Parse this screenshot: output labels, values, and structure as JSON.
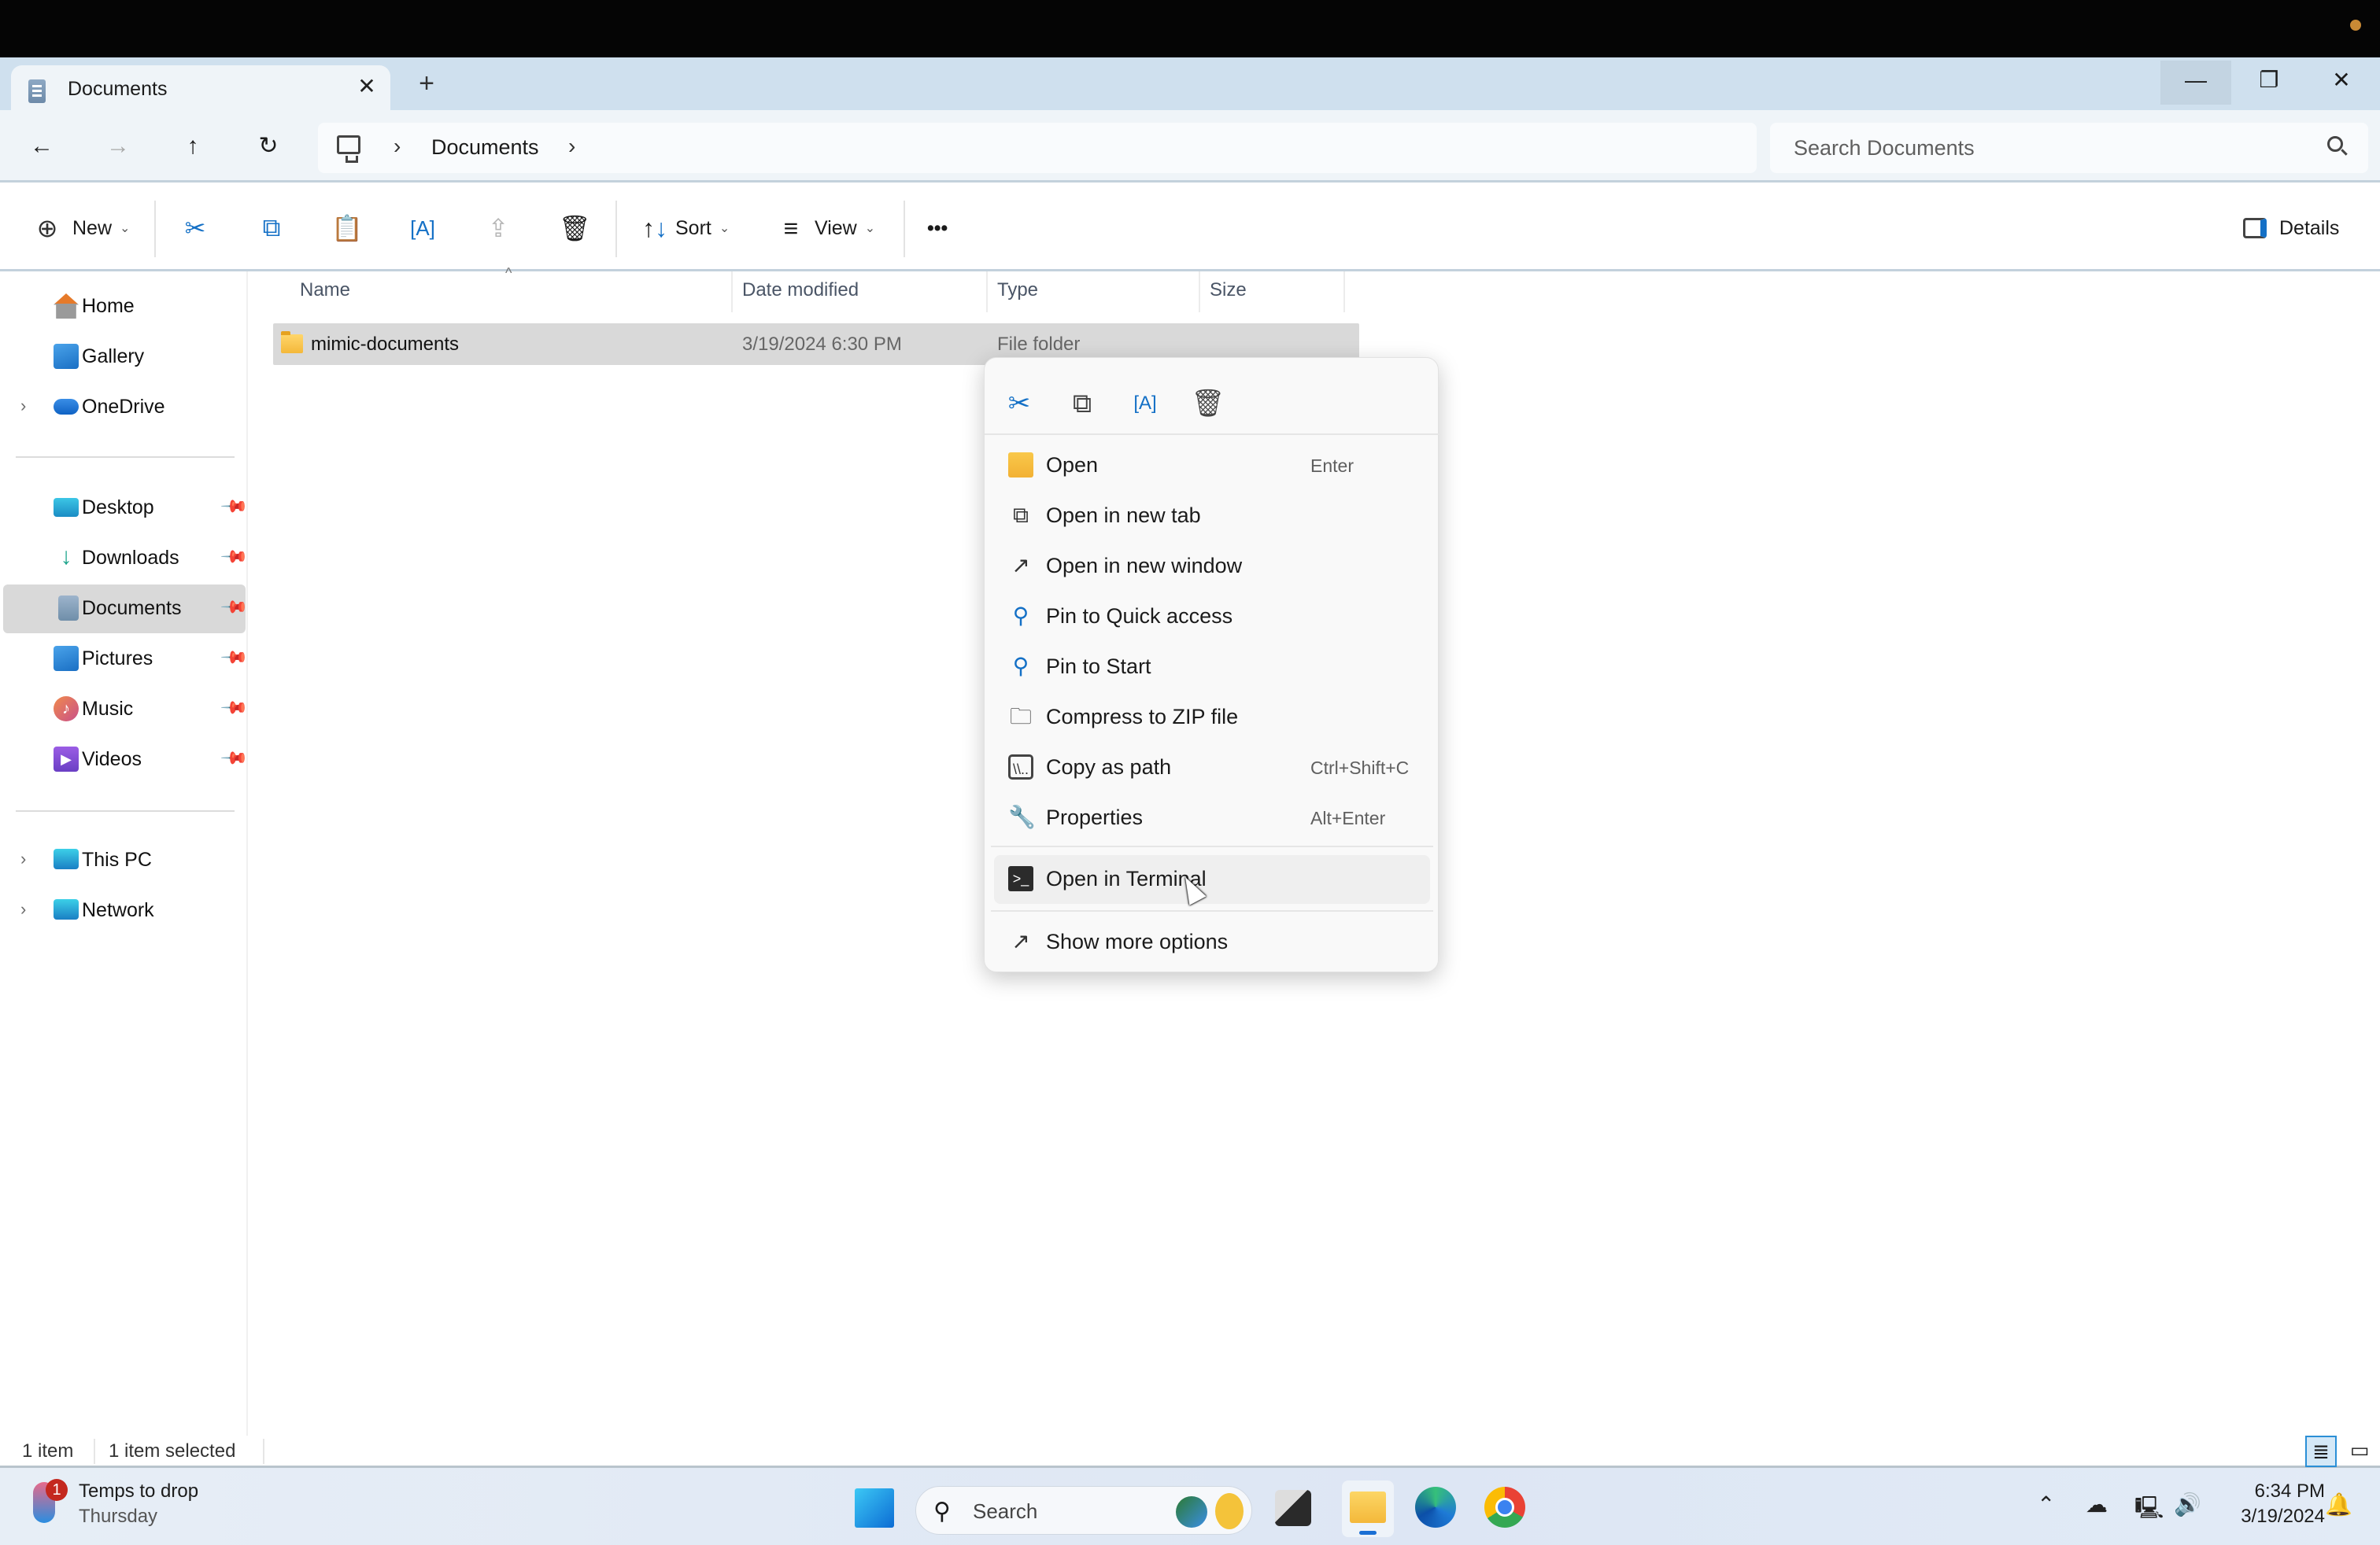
{
  "window": {
    "tab_title": "Documents",
    "tab_icon": "documents-icon",
    "new_tab_label": "+",
    "controls": {
      "minimize": "minimize-icon",
      "restore": "restore-icon",
      "close": "close-icon"
    }
  },
  "address_bar": {
    "root_icon": "this-pc-icon",
    "breadcrumbs": [
      "Documents"
    ],
    "search_placeholder": "Search Documents"
  },
  "nav_buttons": [
    "back",
    "forward",
    "up",
    "refresh"
  ],
  "toolbar": {
    "new_label": "New",
    "sort_label": "Sort",
    "view_label": "View",
    "more_label": "•••",
    "details_label": "Details",
    "icons": [
      "cut-icon",
      "copy-icon",
      "paste-icon",
      "rename-icon",
      "share-icon",
      "delete-icon"
    ]
  },
  "sidebar": {
    "top": [
      {
        "label": "Home",
        "icon": "home-icon",
        "expandable": false
      },
      {
        "label": "Gallery",
        "icon": "gallery-icon",
        "expandable": false
      },
      {
        "label": "OneDrive",
        "icon": "onedrive-icon",
        "expandable": true
      }
    ],
    "quick_access": [
      {
        "label": "Desktop",
        "icon": "desktop-icon",
        "pinned": true,
        "selected": false
      },
      {
        "label": "Downloads",
        "icon": "downloads-icon",
        "pinned": true,
        "selected": false
      },
      {
        "label": "Documents",
        "icon": "documents-icon",
        "pinned": true,
        "selected": true
      },
      {
        "label": "Pictures",
        "icon": "pictures-icon",
        "pinned": true,
        "selected": false
      },
      {
        "label": "Music",
        "icon": "music-icon",
        "pinned": true,
        "selected": false
      },
      {
        "label": "Videos",
        "icon": "videos-icon",
        "pinned": true,
        "selected": false
      }
    ],
    "bottom": [
      {
        "label": "This PC",
        "icon": "this-pc-icon",
        "expandable": true
      },
      {
        "label": "Network",
        "icon": "network-icon",
        "expandable": true
      }
    ]
  },
  "file_list": {
    "columns": [
      "Name",
      "Date modified",
      "Type",
      "Size"
    ],
    "sort_indicator": "^",
    "rows": [
      {
        "name": "mimic-documents",
        "date_modified": "3/19/2024 6:30 PM",
        "type": "File folder",
        "size": "",
        "selected": true
      }
    ]
  },
  "context_menu": {
    "quick_actions": [
      "cut-icon",
      "copy-icon",
      "rename-icon",
      "delete-icon"
    ],
    "items": [
      {
        "label": "Open",
        "shortcut": "Enter",
        "icon": "folder-open-icon"
      },
      {
        "label": "Open in new tab",
        "shortcut": "",
        "icon": "open-new-tab-icon"
      },
      {
        "label": "Open in new window",
        "shortcut": "",
        "icon": "open-new-window-icon"
      },
      {
        "label": "Pin to Quick access",
        "shortcut": "",
        "icon": "pin-icon"
      },
      {
        "label": "Pin to Start",
        "shortcut": "",
        "icon": "pin-icon"
      },
      {
        "label": "Compress to ZIP file",
        "shortcut": "",
        "icon": "zip-icon"
      },
      {
        "label": "Copy as path",
        "shortcut": "Ctrl+Shift+C",
        "icon": "copy-path-icon"
      },
      {
        "label": "Properties",
        "shortcut": "Alt+Enter",
        "icon": "wrench-icon"
      },
      {
        "label": "Open in Terminal",
        "shortcut": "",
        "icon": "terminal-icon",
        "hovered": true
      },
      {
        "label": "Show more options",
        "shortcut": "",
        "icon": "show-more-icon"
      }
    ]
  },
  "status_bar": {
    "item_count": "1 item",
    "selection": "1 item selected"
  },
  "taskbar": {
    "weather": {
      "title": "Temps to drop",
      "subtitle": "Thursday",
      "badge": "1"
    },
    "search_label": "Search",
    "apps": [
      "start-icon",
      "task-view-icon",
      "file-explorer-icon",
      "edge-icon",
      "chrome-icon"
    ],
    "time": "6:34 PM",
    "date": "3/19/2024"
  }
}
